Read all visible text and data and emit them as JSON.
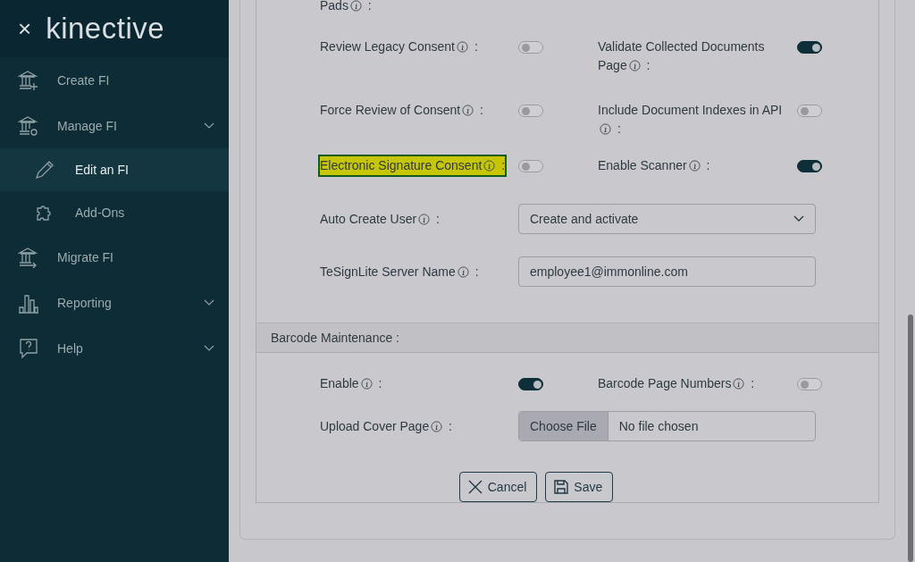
{
  "sidebar": {
    "close": "×",
    "logo": "kinective",
    "items": [
      {
        "label": "Create FI",
        "kind": "link",
        "selected": false
      },
      {
        "label": "Manage FI",
        "kind": "group",
        "selected": false,
        "children": [
          {
            "label": "Edit an FI",
            "selected": true
          },
          {
            "label": "Add-Ons",
            "selected": false
          }
        ]
      },
      {
        "label": "Migrate FI",
        "kind": "link",
        "selected": false
      },
      {
        "label": "Reporting",
        "kind": "group",
        "selected": false
      },
      {
        "label": "Help",
        "kind": "group",
        "selected": false
      }
    ]
  },
  "sections": [
    {
      "fields": [
        {
          "kind": "label",
          "label": "Pads",
          "suffix": ":",
          "highlighted": false
        },
        {
          "kind": "spacer"
        },
        {
          "kind": "toggle",
          "label": "Review Legacy Consent",
          "suffix": ":",
          "on": false,
          "highlighted": false
        },
        {
          "kind": "toggle",
          "label": "Validate Collected Documents Page",
          "suffix": ":",
          "on": true,
          "highlighted": false
        },
        {
          "kind": "toggle",
          "label": "Force Review of Consent",
          "suffix": ":",
          "on": false,
          "highlighted": false
        },
        {
          "kind": "toggle",
          "label": "Include Document Indexes in API",
          "suffix": ":",
          "on": false,
          "highlighted": false
        },
        {
          "kind": "toggle",
          "label": "Electronic Signature Consent",
          "suffix": ":",
          "on": false,
          "highlighted": true
        },
        {
          "kind": "toggle",
          "label": "Enable Scanner",
          "suffix": ":",
          "on": true,
          "highlighted": false
        },
        {
          "kind": "select",
          "label": "Auto Create User",
          "suffix": ":",
          "value": "Create and activate",
          "highlighted": false
        },
        {
          "kind": "text",
          "label": "TeSignLite Server Name",
          "suffix": ":",
          "value": "employee1@immonline.com",
          "highlighted": false
        }
      ]
    },
    {
      "title": "Barcode Maintenance :",
      "fields": [
        {
          "kind": "toggle",
          "label": "Enable",
          "suffix": ":",
          "on": true,
          "highlighted": false
        },
        {
          "kind": "toggle",
          "label": "Barcode Page Numbers",
          "suffix": ":",
          "on": false,
          "highlighted": false
        },
        {
          "kind": "file",
          "label": "Upload Cover Page",
          "suffix": ":",
          "button": "Choose File",
          "value": "No file chosen",
          "highlighted": false
        }
      ]
    }
  ],
  "buttons": [
    {
      "label": "Cancel",
      "kind": "cancel"
    },
    {
      "label": "Save",
      "kind": "save"
    }
  ]
}
